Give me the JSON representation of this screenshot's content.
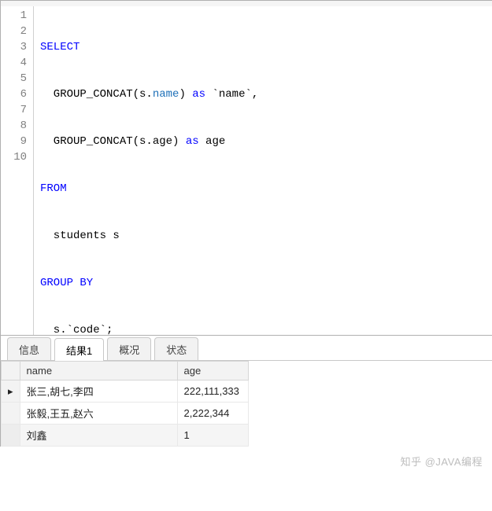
{
  "editor": {
    "total_lines": 10,
    "tokens": {
      "select": "SELECT",
      "concat1a": "  GROUP_CONCAT(s.",
      "concat1_col": "name",
      "concat1b": ") ",
      "as": "as",
      "alias1": " `name`,",
      "concat2a": "  GROUP_CONCAT(s.age) ",
      "alias2": " age",
      "from": "FROM",
      "from_body": "  students s",
      "group_by": "GROUP BY",
      "group_body": "  s.`code`;"
    }
  },
  "tabs": [
    {
      "label": "信息",
      "active": false
    },
    {
      "label": "结果1",
      "active": true
    },
    {
      "label": "概况",
      "active": false
    },
    {
      "label": "状态",
      "active": false
    }
  ],
  "results": {
    "columns": [
      "name",
      "age"
    ],
    "rows": [
      {
        "marker": "▸",
        "name": "张三,胡七,李四",
        "age": "222,111,333"
      },
      {
        "marker": "",
        "name": "张毅,王五,赵六",
        "age": "2,222,344"
      },
      {
        "marker": "",
        "name": "刘鑫",
        "age": "1"
      }
    ]
  },
  "watermark": "知乎 @JAVA编程"
}
